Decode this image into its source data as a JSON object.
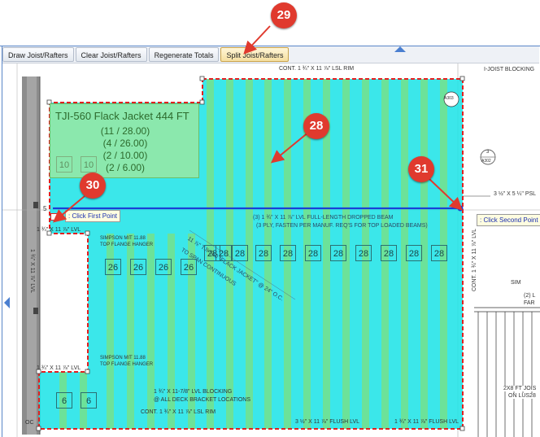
{
  "toolbar": {
    "buttons": [
      {
        "label": "Draw Joist/Rafters"
      },
      {
        "label": "Clear Joist/Rafters"
      },
      {
        "label": "Regenerate Totals"
      },
      {
        "label": "Split Joist/Rafters"
      }
    ]
  },
  "callouts": {
    "c28": "28",
    "c29": "29",
    "c30": "30",
    "c31": "31"
  },
  "info_panel": {
    "title": "TJI-560 Flack Jacket 444 FT",
    "lines": [
      "(11 / 28.00)",
      "(4 / 26.00)",
      "(2 / 10.00)",
      "(2 / 6.00)"
    ]
  },
  "tooltips": {
    "first_point": ": Click First Point",
    "second_point": ": Click Second Point"
  },
  "joist_labels": {
    "row28": [
      "28",
      "28",
      "28",
      "28",
      "28",
      "28",
      "28",
      "28",
      "28",
      "28",
      "28"
    ],
    "row26": [
      "26",
      "26",
      "26",
      "26"
    ],
    "row10": [
      "10",
      "10"
    ],
    "row6": [
      "6",
      "6"
    ]
  },
  "drawing_labels": {
    "top_rim": "CONT. 1 ¾\" X 11 ⅞\" LSL RIM",
    "ijoist_blocking": "I-JOIST BLOCKING",
    "lvl_top_left": "1 ¾\" X 11 ⅞\" LVL",
    "simpson_1a": "SIMPSON MIT 11.88",
    "simpson_1b": "TOP FLANGE HANGER",
    "lvl_vertical": "1 ¾\" X 11 ⅞\" LVL",
    "lvl_bottom_left": "1 ¾\" X 11 ⅞\" LVL",
    "simpson_2a": "SIMPSON MIT 11.88",
    "simpson_2b": "TOP FLANGE HANGER",
    "beam_1": "(3) 1 ¾\" X 11 ⅞\" LVL FULL-LENGTH DROPPED BEAM",
    "beam_2": "(3 PLY, FASTEN PER MANUF. REQ'S FOR TOP LOADED BEAMS)",
    "joist_diag_1": "11 ⅞\" TJI-560 \"FLACK JACKET\" @ 24\" O.C.",
    "joist_diag_2": "TO SPAN CONTINUOUS",
    "psl": "3 ½\" X 5 ¼\" PSL",
    "right_rim": "CONT. 1 ¾\" X 11 ⅞\" LVL",
    "lvl_blocking_1": "1 ¾\" X 11-7/8\" LVL BLOCKING",
    "lvl_blocking_2": "@ ALL DECK BRACKET LOCATIONS",
    "bottom_rim": "CONT. 1 ¾\" X 11 ⅞\" LSL RIM",
    "flush_lvl": "3 ½\" X 11 ⅞\" FLUSH LVL",
    "flush_lvl_r": "1 ¾\" X 11 ⅞\" FLUSH LVL",
    "sim": "SIM",
    "two_far_1": "(2) L",
    "two_far_2": "FAR",
    "joists_2x8_1": "2X8 FT JOIS",
    "joists_2x8_2": "ON LUS28",
    "ref_a303": "A303",
    "ref_3": "3",
    "ref_a302": "A302",
    "oc_left": "OC",
    "mark_5": "5"
  },
  "colors": {
    "area_fill": "#19e3e6",
    "joist_green": "#7ee07e",
    "selection_red": "#e02020",
    "split_line_blue": "#1a3fd6",
    "callout_red": "#e03a2e"
  }
}
